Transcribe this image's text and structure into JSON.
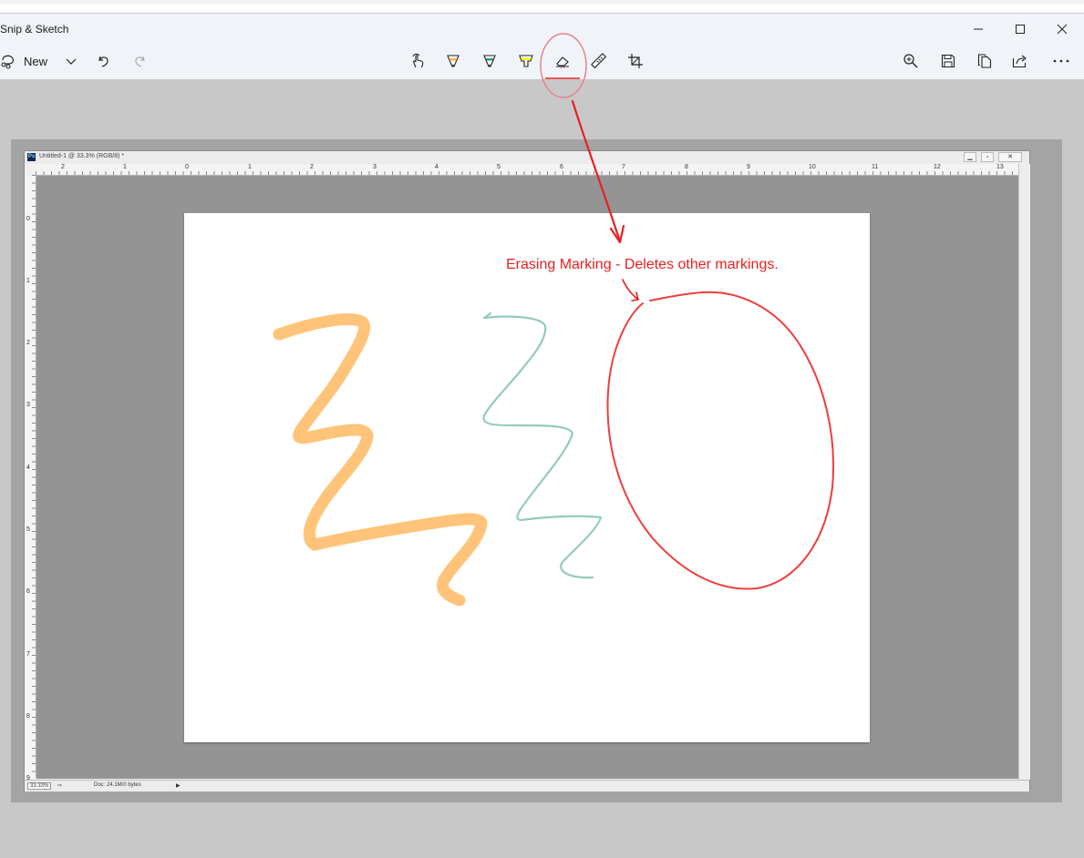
{
  "window": {
    "title": "Snip & Sketch",
    "controls": [
      "minimize-icon",
      "maximize-icon",
      "close-icon"
    ]
  },
  "toolbar": {
    "new_label": "New",
    "left_tools": [
      "snip-icon",
      "chevron-down-icon",
      "undo-icon",
      "redo-icon"
    ],
    "center_tools": [
      "touch-writing-icon",
      "ballpoint-pen-icon",
      "pencil-icon",
      "highlighter-icon",
      "eraser-icon",
      "ruler-icon",
      "crop-icon"
    ],
    "right_tools": [
      "zoom-icon",
      "save-icon",
      "copy-icon",
      "share-icon",
      "more-icon"
    ],
    "active_tool": "eraser",
    "accent_color": "#e81123"
  },
  "photoshop": {
    "doc_title": "Untitled-1 @ 33.3% (RGB/8) *",
    "ps_logo": "Ps",
    "ruler_top_labels": [
      "2",
      "1",
      "0",
      "1",
      "2",
      "3",
      "4",
      "5",
      "6",
      "7",
      "8",
      "9",
      "10",
      "11",
      "12",
      "13"
    ],
    "ruler_left_labels": [
      "0",
      "1",
      "2",
      "3",
      "4",
      "5",
      "6",
      "7",
      "8",
      "9"
    ],
    "status_zoom": "33.33%",
    "status_doc": "Doc: 24.1M/0 bytes"
  },
  "annotation": {
    "text": "Erasing Marking - Deletes other markings.",
    "color": "#e8201f"
  },
  "strokes": {
    "orange": "#ffc47a",
    "teal": "#94cbbd",
    "red": "#e8201f"
  }
}
